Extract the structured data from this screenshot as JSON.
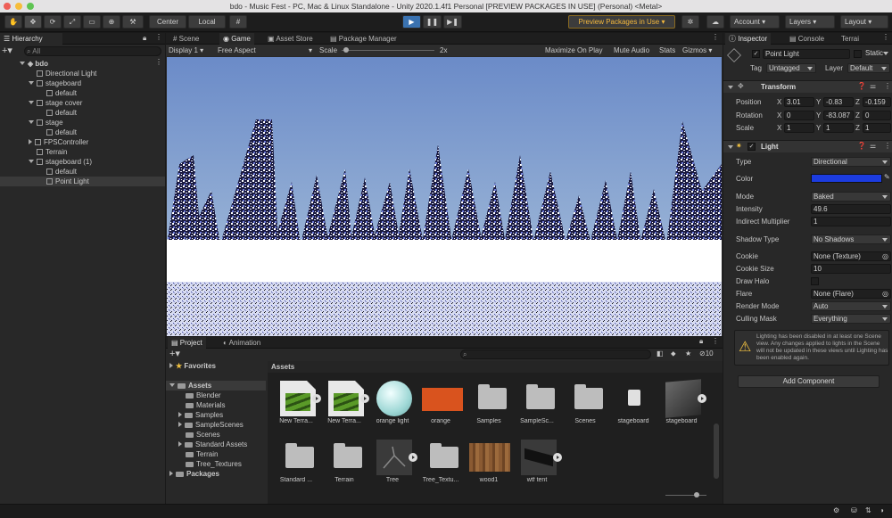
{
  "window": {
    "title": "bdo - Music Fest - PC, Mac & Linux Standalone - Unity 2020.1.4f1 Personal [PREVIEW PACKAGES IN USE] (Personal) <Metal>"
  },
  "toolbar": {
    "center": "Center",
    "local": "Local",
    "preview": "Preview Packages in Use",
    "account": "Account",
    "layers": "Layers",
    "layout": "Layout"
  },
  "hierarchy": {
    "tab": "Hierarchy",
    "search": "All",
    "scene": "bdo",
    "items": [
      "Directional Light",
      "stageboard",
      "default",
      "stage cover",
      "default",
      "stage",
      "default",
      "FPSController",
      "Terrain",
      "stageboard (1)",
      "default",
      "Point Light"
    ]
  },
  "view": {
    "tabs": [
      "Scene",
      "Game",
      "Asset Store",
      "Package Manager"
    ],
    "display": "Display 1",
    "aspect": "Free Aspect",
    "scale_label": "Scale",
    "scale_value": "2x",
    "options": [
      "Maximize On Play",
      "Mute Audio",
      "Stats",
      "Gizmos"
    ]
  },
  "project": {
    "tabs": [
      "Project",
      "Animation"
    ],
    "count": "10",
    "favorites": "Favorites",
    "assets": "Assets",
    "tree": [
      "Blender",
      "Materials",
      "Samples",
      "SampleScenes",
      "Scenes",
      "Standard Assets",
      "Terrain",
      "Tree_Textures"
    ],
    "packages": "Packages",
    "breadcrumb": "Assets",
    "items": [
      "New Terra...",
      "New Terra...",
      "orange light",
      "orange",
      "Samples",
      "SampleSc...",
      "Scenes",
      "stageboard",
      "stageboard",
      "Standard ...",
      "Terrain",
      "Tree",
      "Tree_Textu...",
      "wood1",
      "wtf tent"
    ]
  },
  "inspector": {
    "tabs": [
      "Inspector",
      "Console",
      "Terrai"
    ],
    "object_name": "Point Light",
    "static": "Static",
    "tag_label": "Tag",
    "tag": "Untagged",
    "layer_label": "Layer",
    "layer": "Default",
    "transform": {
      "title": "Transform",
      "position": {
        "label": "Position",
        "x": "3.01",
        "y": "-0.83",
        "z": "-0.159"
      },
      "rotation": {
        "label": "Rotation",
        "x": "0",
        "y": "-83.087",
        "z": "0"
      },
      "scale": {
        "label": "Scale",
        "x": "1",
        "y": "1",
        "z": "1"
      }
    },
    "light": {
      "title": "Light",
      "type_label": "Type",
      "type": "Directional",
      "color_label": "Color",
      "color": "#1c3ce0",
      "mode_label": "Mode",
      "mode": "Baked",
      "intensity_label": "Intensity",
      "intensity": "49.6",
      "indirect_label": "Indirect Multiplier",
      "indirect": "1",
      "shadow_label": "Shadow Type",
      "shadow": "No Shadows",
      "cookie_label": "Cookie",
      "cookie": "None (Texture)",
      "cookie_size_label": "Cookie Size",
      "cookie_size": "10",
      "halo_label": "Draw Halo",
      "flare_label": "Flare",
      "flare": "None (Flare)",
      "render_label": "Render Mode",
      "render": "Auto",
      "culling_label": "Culling Mask",
      "culling": "Everything"
    },
    "warning": "Lighting has been disabled in at least one Scene view. Any changes applied to lights in the Scene will not be updated in these views until Lighting has been enabled again.",
    "add_component": "Add Component"
  }
}
